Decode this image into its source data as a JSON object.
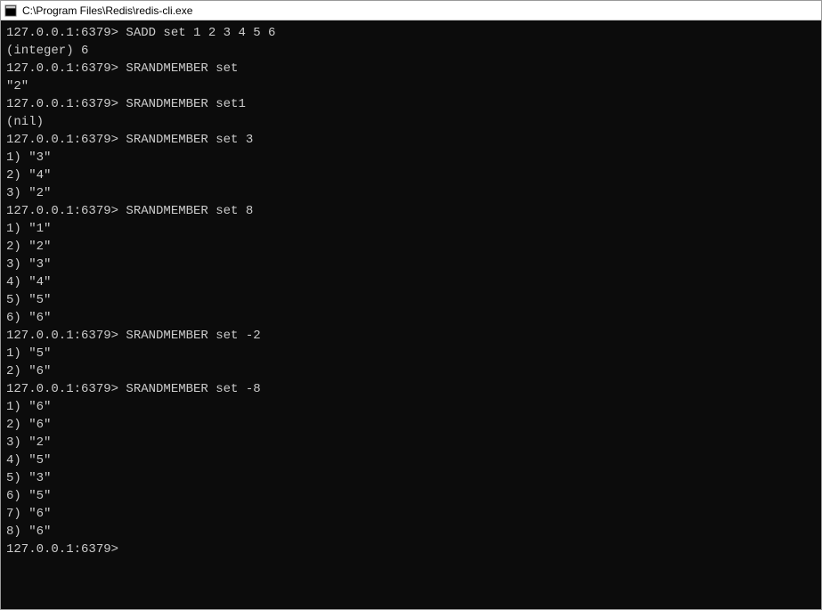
{
  "window": {
    "title": "C:\\Program Files\\Redis\\redis-cli.exe"
  },
  "terminal": {
    "prompt": "127.0.0.1:6379>",
    "lines": [
      {
        "type": "cmd",
        "prompt": "127.0.0.1:6379>",
        "command": "SADD set 1 2 3 4 5 6"
      },
      {
        "type": "out",
        "text": "(integer) 6"
      },
      {
        "type": "cmd",
        "prompt": "127.0.0.1:6379>",
        "command": "SRANDMEMBER set"
      },
      {
        "type": "out",
        "text": "\"2\""
      },
      {
        "type": "cmd",
        "prompt": "127.0.0.1:6379>",
        "command": "SRANDMEMBER set1"
      },
      {
        "type": "out",
        "text": "(nil)"
      },
      {
        "type": "cmd",
        "prompt": "127.0.0.1:6379>",
        "command": "SRANDMEMBER set 3"
      },
      {
        "type": "out",
        "text": "1) \"3\""
      },
      {
        "type": "out",
        "text": "2) \"4\""
      },
      {
        "type": "out",
        "text": "3) \"2\""
      },
      {
        "type": "cmd",
        "prompt": "127.0.0.1:6379>",
        "command": "SRANDMEMBER set 8"
      },
      {
        "type": "out",
        "text": "1) \"1\""
      },
      {
        "type": "out",
        "text": "2) \"2\""
      },
      {
        "type": "out",
        "text": "3) \"3\""
      },
      {
        "type": "out",
        "text": "4) \"4\""
      },
      {
        "type": "out",
        "text": "5) \"5\""
      },
      {
        "type": "out",
        "text": "6) \"6\""
      },
      {
        "type": "cmd",
        "prompt": "127.0.0.1:6379>",
        "command": "SRANDMEMBER set -2"
      },
      {
        "type": "out",
        "text": "1) \"5\""
      },
      {
        "type": "out",
        "text": "2) \"6\""
      },
      {
        "type": "cmd",
        "prompt": "127.0.0.1:6379>",
        "command": "SRANDMEMBER set -8"
      },
      {
        "type": "out",
        "text": "1) \"6\""
      },
      {
        "type": "out",
        "text": "2) \"6\""
      },
      {
        "type": "out",
        "text": "3) \"2\""
      },
      {
        "type": "out",
        "text": "4) \"5\""
      },
      {
        "type": "out",
        "text": "5) \"3\""
      },
      {
        "type": "out",
        "text": "6) \"5\""
      },
      {
        "type": "out",
        "text": "7) \"6\""
      },
      {
        "type": "out",
        "text": "8) \"6\""
      },
      {
        "type": "prompt-only",
        "prompt": "127.0.0.1:6379>"
      }
    ]
  }
}
